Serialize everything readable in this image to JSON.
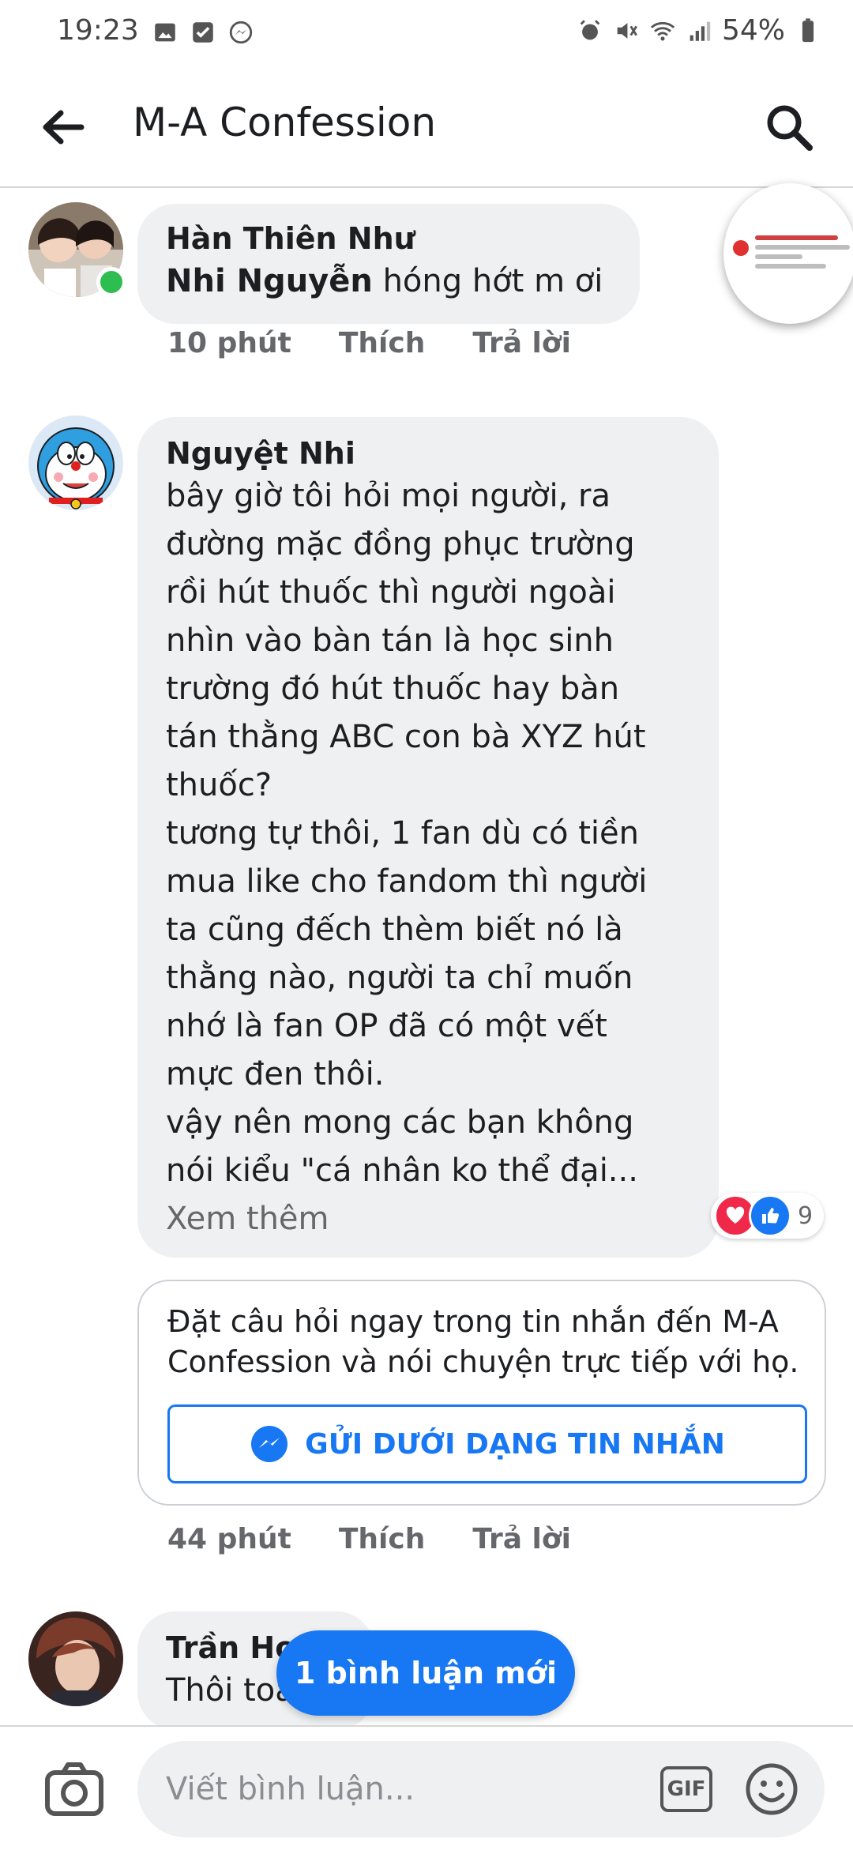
{
  "status_bar": {
    "time": "19:23",
    "battery": "54%"
  },
  "header": {
    "title": "M-A Confession"
  },
  "comments": [
    {
      "author": "Hàn Thiên Như",
      "mention": "Nhi Nguyễn",
      "text": " hóng hớt m ơi",
      "time": "10 phút",
      "like_label": "Thích",
      "reply_label": "Trả lời"
    },
    {
      "author": "Nguyệt Nhi",
      "lines": [
        "bây giờ tôi hỏi mọi người, ra",
        "đường mặc đồng phục trường",
        "rồi hút thuốc thì người ngoài",
        "nhìn vào bàn tán là học sinh",
        "trường đó hút thuốc hay bàn",
        "tán thằng ABC con bà XYZ hút",
        "thuốc?",
        "tương tự thôi, 1 fan dù có tiền",
        "mua like cho fandom thì người",
        "ta cũng đếch thèm biết nó là",
        "thằng nào, người ta chỉ muốn",
        "nhớ là fan OP đã có một vết",
        "mực đen thôi.",
        "vậy nên mong các bạn không",
        "nói kiểu \"cá nhân ko thể đại..."
      ],
      "see_more": "Xem thêm",
      "reaction_count": "9",
      "time": "44 phút",
      "like_label": "Thích",
      "reply_label": "Trả lời"
    },
    {
      "author": "Trần Ho",
      "text": "Thôi toà"
    }
  ],
  "message_prompt": {
    "text": "Đặt câu hỏi ngay trong tin nhắn đến M-A Confession và nói chuyện trực tiếp với họ.",
    "button_label": "GỬI DƯỚI DẠNG TIN NHẮN"
  },
  "new_comments_label": "1 bình luận mới",
  "composer": {
    "placeholder": "Viết bình luận...",
    "gif_label": "GIF"
  },
  "colors": {
    "accent": "#1877f2",
    "bubble": "#eff0f2",
    "online": "#2dbe4f"
  }
}
